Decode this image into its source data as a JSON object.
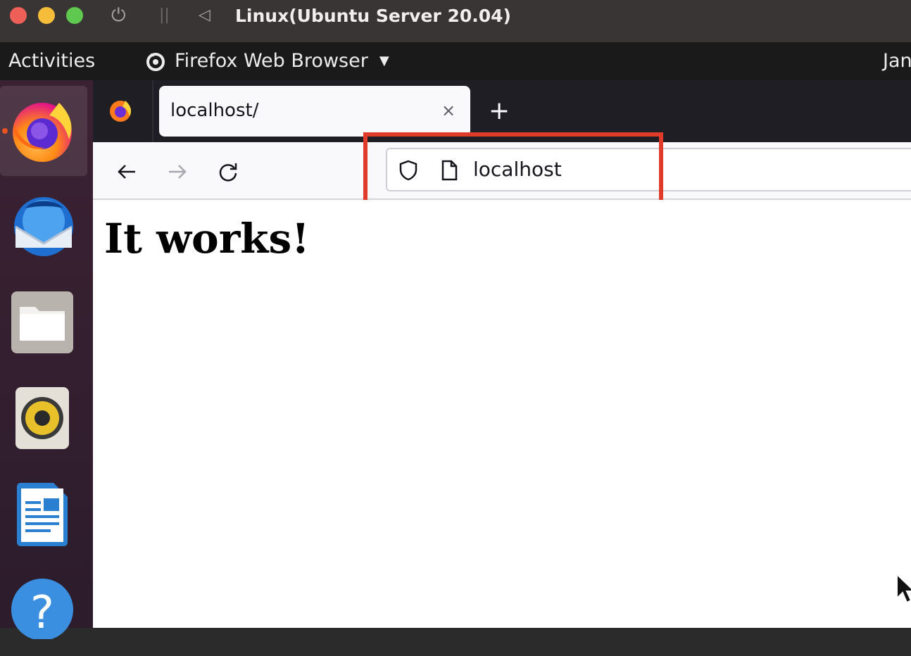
{
  "vm_window": {
    "title": "Linux(Ubuntu Server 20.04)",
    "controls": {
      "power": "⏻",
      "pause": "||",
      "back": "◁"
    }
  },
  "gnome_topbar": {
    "activities": "Activities",
    "app_menu": "Firefox Web Browser",
    "clock_partial": "Jan"
  },
  "dock": {
    "items": [
      "firefox-icon",
      "thunderbird-icon",
      "files-icon",
      "rhythmbox-icon",
      "libreoffice-writer-icon",
      "help-icon"
    ],
    "running_color": "#e95420"
  },
  "browser": {
    "tab": {
      "title": "localhost/",
      "close": "×"
    },
    "new_tab": "+",
    "url": "localhost"
  },
  "page": {
    "heading": "It works!"
  },
  "annotation": {
    "color": "#e03a2b"
  }
}
